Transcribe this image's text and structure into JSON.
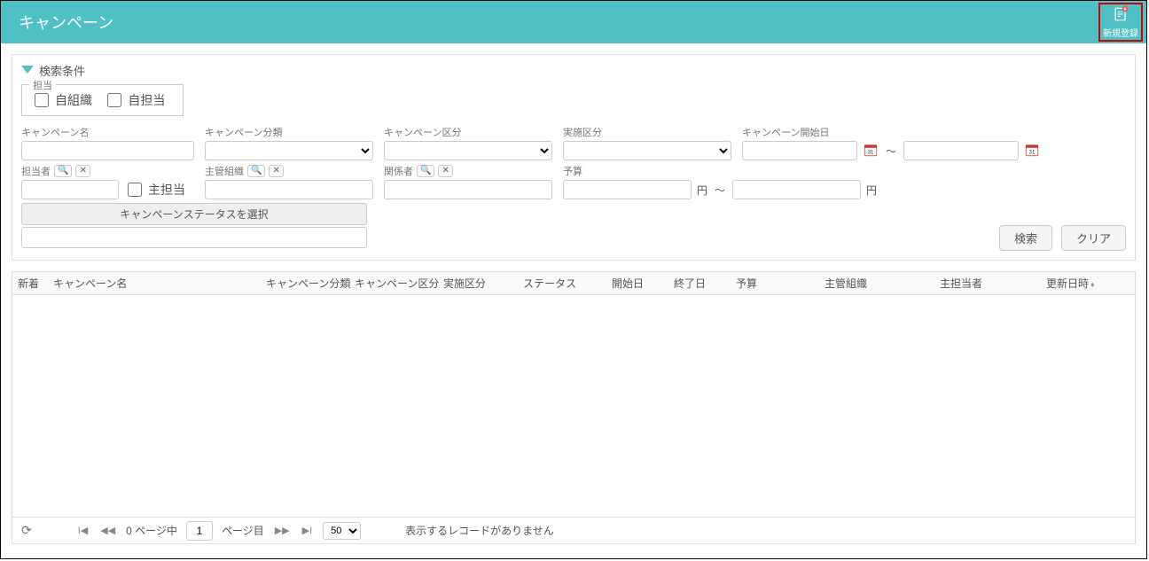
{
  "header": {
    "title": "キャンペーン",
    "new_register": "新規登録"
  },
  "search": {
    "title": "検索条件",
    "tantou_legend": "担当",
    "chk_own_org": "自組織",
    "chk_own_person": "自担当",
    "labels": {
      "campaign_name": "キャンペーン名",
      "campaign_class": "キャンペーン分類",
      "campaign_kubun": "キャンペーン区分",
      "jisshi_kubun": "実施区分",
      "start_date": "キャンペーン開始日",
      "tantousha": "担当者",
      "main_tantou": "主担当",
      "shukan_soshiki": "主管組織",
      "kankeisha": "関係者",
      "yosan": "予算",
      "yen": "円",
      "range_sep": "～"
    },
    "status_btn": "キャンペーンステータスを選択",
    "btn_search": "検索",
    "btn_clear": "クリア"
  },
  "grid": {
    "cols": {
      "new": "新着",
      "name": "キャンペーン名",
      "class": "キャンペーン分類",
      "kubun": "キャンペーン区分",
      "jisshi": "実施区分",
      "status": "ステータス",
      "start": "開始日",
      "end": "終了日",
      "yosan": "予算",
      "soshiki": "主管組織",
      "shutantou": "主担当者",
      "updated": "更新日時"
    },
    "footer": {
      "pages_total_prefix": "0 ページ中",
      "page_value": "1",
      "pages_suffix": "ページ目",
      "page_size": "50",
      "no_records": "表示するレコードがありません"
    }
  }
}
